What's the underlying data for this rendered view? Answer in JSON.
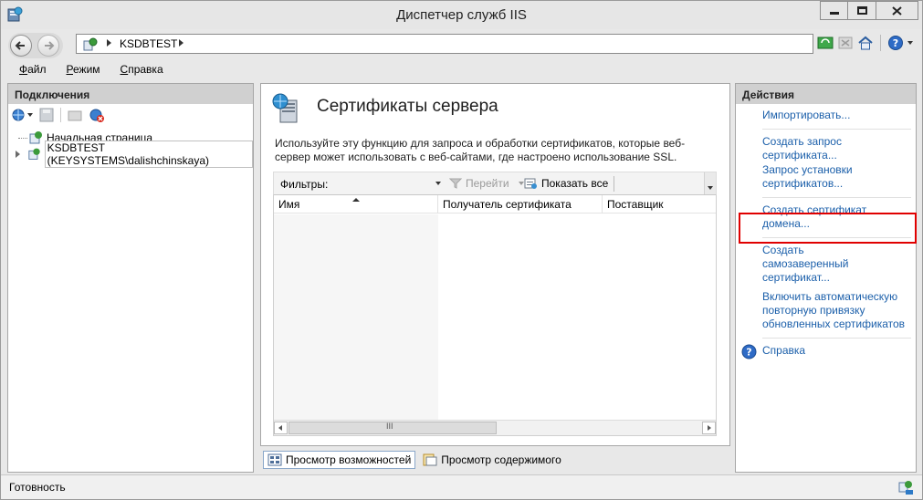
{
  "window": {
    "title": "Диспетчер служб IIS",
    "controls": [
      "minimize",
      "maximize",
      "close"
    ]
  },
  "address_bar": {
    "crumbs": [
      "KSDBTEST"
    ]
  },
  "menu": {
    "items": [
      {
        "label": "Файл",
        "hotkey": "Ф"
      },
      {
        "label": "Режим",
        "hotkey": "Р"
      },
      {
        "label": "Справка",
        "hotkey": "С"
      }
    ]
  },
  "connections": {
    "header": "Подключения",
    "tree": [
      {
        "label": "Начальная страница",
        "expandable": false
      },
      {
        "label": "KSDBTEST (KEYSYSTEMS\\dalishchinskaya)",
        "expandable": true
      }
    ]
  },
  "center": {
    "title": "Сертификаты сервера",
    "description": "Используйте эту функцию для запроса и обработки сертификатов, которые веб-сервер может использовать с веб-сайтами, где настроено использование SSL.",
    "filter_label": "Фильтры:",
    "filter_value": "",
    "go_label": "Перейти",
    "show_all_label": "Показать все",
    "columns": [
      "Имя",
      "Получатель сертификата",
      "Поставщик"
    ],
    "rows": [],
    "scrollbar_thumb_symbol": "III"
  },
  "view_tabs": {
    "features": "Просмотр возможностей",
    "content": "Просмотр содержимого"
  },
  "actions": {
    "header": "Действия",
    "items": [
      {
        "label": "Импортировать...",
        "icon": ""
      },
      {
        "label": "Создать запрос сертификата...",
        "icon": ""
      },
      {
        "label": "Запрос установки сертификатов...",
        "icon": ""
      },
      {
        "label": "Создать сертификат домена...",
        "icon": ""
      },
      {
        "label": "Создать самозаверенный сертификат...",
        "icon": "",
        "highlighted": true
      },
      {
        "label": "Включить автоматическую повторную привязку обновленных сертификатов",
        "icon": ""
      },
      {
        "label": "Справка",
        "icon": "help-icon"
      }
    ],
    "highlight_color": "#e00000",
    "link_color": "#1b5faa"
  },
  "status": {
    "text": "Готовность"
  }
}
